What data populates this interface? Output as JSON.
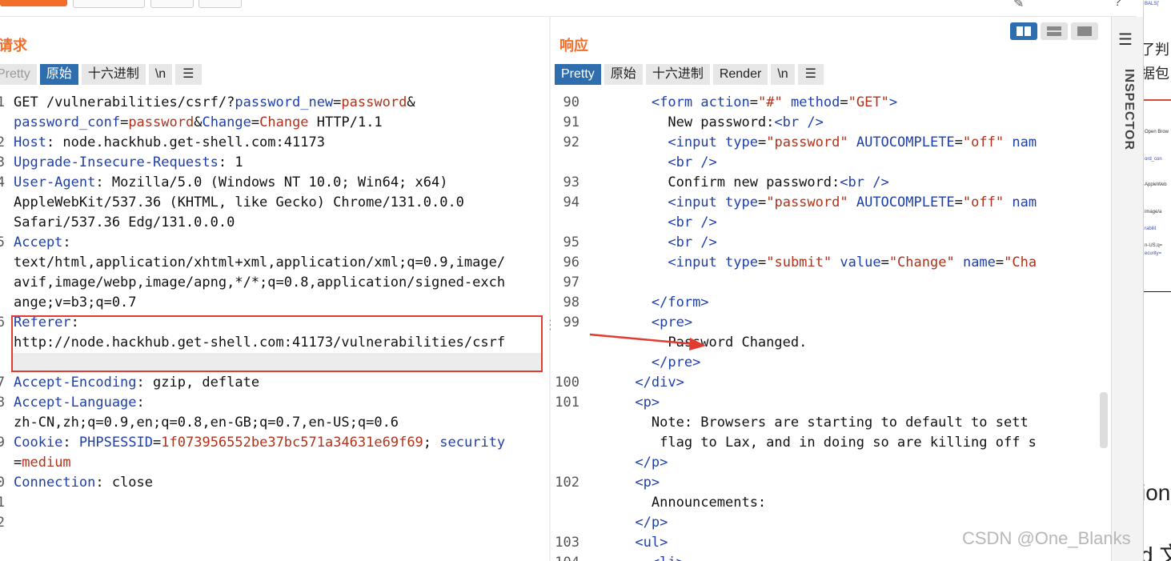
{
  "request": {
    "title": "请求",
    "tabs": [
      "Pretty",
      "原始",
      "十六进制",
      "\\n"
    ],
    "lines": [
      {
        "n": "1",
        "segs": [
          [
            "t",
            "GET /vulnerabilities/csrf/?"
          ],
          [
            "k",
            "password_new"
          ],
          [
            "t",
            "="
          ],
          [
            "v",
            "password"
          ],
          [
            "t",
            "&"
          ]
        ]
      },
      {
        "n": "",
        "segs": [
          [
            "k",
            "password_conf"
          ],
          [
            "t",
            "="
          ],
          [
            "v",
            "password"
          ],
          [
            "t",
            "&"
          ],
          [
            "k",
            "Change"
          ],
          [
            "t",
            "="
          ],
          [
            "v",
            "Change"
          ],
          [
            "t",
            " HTTP/1.1"
          ]
        ]
      },
      {
        "n": "2",
        "segs": [
          [
            "k",
            "Host"
          ],
          [
            "t",
            ": node.hackhub.get-shell.com:41173"
          ]
        ]
      },
      {
        "n": "3",
        "segs": [
          [
            "k",
            "Upgrade-Insecure-Requests"
          ],
          [
            "t",
            ": 1"
          ]
        ]
      },
      {
        "n": "4",
        "segs": [
          [
            "k",
            "User-Agent"
          ],
          [
            "t",
            ": Mozilla/5.0 (Windows NT 10.0; Win64; x64)"
          ]
        ]
      },
      {
        "n": "",
        "segs": [
          [
            "t",
            "AppleWebKit/537.36 (KHTML, like Gecko) Chrome/131.0.0.0"
          ]
        ]
      },
      {
        "n": "",
        "segs": [
          [
            "t",
            "Safari/537.36 Edg/131.0.0.0"
          ]
        ]
      },
      {
        "n": "5",
        "segs": [
          [
            "k",
            "Accept"
          ],
          [
            "t",
            ":"
          ]
        ]
      },
      {
        "n": "",
        "segs": [
          [
            "t",
            "text/html,application/xhtml+xml,application/xml;q=0.9,image/"
          ]
        ]
      },
      {
        "n": "",
        "segs": [
          [
            "t",
            "avif,image/webp,image/apng,*/*;q=0.8,application/signed-exch"
          ]
        ]
      },
      {
        "n": "",
        "segs": [
          [
            "t",
            "ange;v=b3;q=0.7"
          ]
        ]
      },
      {
        "n": "6",
        "segs": [
          [
            "k",
            "Referer"
          ],
          [
            "t",
            ":"
          ]
        ]
      },
      {
        "n": "",
        "segs": [
          [
            "t",
            "http://node.hackhub.get-shell.com:41173/vulnerabilities/csrf"
          ]
        ]
      },
      {
        "n": "",
        "segs": [
          [
            "t",
            "/"
          ]
        ]
      },
      {
        "n": "7",
        "segs": [
          [
            "k",
            "Accept-Encoding"
          ],
          [
            "t",
            ": gzip, deflate"
          ]
        ]
      },
      {
        "n": "8",
        "segs": [
          [
            "k",
            "Accept-Language"
          ],
          [
            "t",
            ":"
          ]
        ]
      },
      {
        "n": "",
        "segs": [
          [
            "t",
            "zh-CN,zh;q=0.9,en;q=0.8,en-GB;q=0.7,en-US;q=0.6"
          ]
        ]
      },
      {
        "n": "9",
        "segs": [
          [
            "k",
            "Cookie"
          ],
          [
            "t",
            ": "
          ],
          [
            "k",
            "PHPSESSID"
          ],
          [
            "t",
            "="
          ],
          [
            "v",
            "1f073956552be37bc571a34631e69f69"
          ],
          [
            "t",
            "; "
          ],
          [
            "k",
            "security"
          ]
        ]
      },
      {
        "n": "",
        "segs": [
          [
            "t",
            "="
          ],
          [
            "v",
            "medium"
          ]
        ]
      },
      {
        "n": "0",
        "segs": [
          [
            "k",
            "Connection"
          ],
          [
            "t",
            ": close"
          ]
        ]
      },
      {
        "n": "1",
        "segs": []
      },
      {
        "n": "2",
        "segs": []
      }
    ]
  },
  "response": {
    "title": "响应",
    "tabs": [
      "Pretty",
      "原始",
      "十六进制",
      "Render",
      "\\n"
    ],
    "lines": [
      {
        "n": "90",
        "segs": [
          [
            "t",
            "        "
          ],
          [
            "tag",
            "<form"
          ],
          [
            "t",
            " "
          ],
          [
            "attr",
            "action"
          ],
          [
            "t",
            "="
          ],
          [
            "str",
            "\"#\""
          ],
          [
            "t",
            " "
          ],
          [
            "attr",
            "method"
          ],
          [
            "t",
            "="
          ],
          [
            "str",
            "\"GET\""
          ],
          [
            "tag",
            ">"
          ]
        ]
      },
      {
        "n": "91",
        "segs": [
          [
            "t",
            "          New password:"
          ],
          [
            "tag",
            "<br />"
          ]
        ]
      },
      {
        "n": "92",
        "segs": [
          [
            "t",
            "          "
          ],
          [
            "tag",
            "<input"
          ],
          [
            "t",
            " "
          ],
          [
            "attr",
            "type"
          ],
          [
            "t",
            "="
          ],
          [
            "str",
            "\"password\""
          ],
          [
            "t",
            " "
          ],
          [
            "attr",
            "AUTOCOMPLETE"
          ],
          [
            "t",
            "="
          ],
          [
            "str",
            "\"off\""
          ],
          [
            "t",
            " "
          ],
          [
            "attr",
            "nam"
          ]
        ]
      },
      {
        "n": "",
        "segs": [
          [
            "t",
            "          "
          ],
          [
            "tag",
            "<br />"
          ]
        ]
      },
      {
        "n": "93",
        "segs": [
          [
            "t",
            "          Confirm new password:"
          ],
          [
            "tag",
            "<br />"
          ]
        ]
      },
      {
        "n": "94",
        "segs": [
          [
            "t",
            "          "
          ],
          [
            "tag",
            "<input"
          ],
          [
            "t",
            " "
          ],
          [
            "attr",
            "type"
          ],
          [
            "t",
            "="
          ],
          [
            "str",
            "\"password\""
          ],
          [
            "t",
            " "
          ],
          [
            "attr",
            "AUTOCOMPLETE"
          ],
          [
            "t",
            "="
          ],
          [
            "str",
            "\"off\""
          ],
          [
            "t",
            " "
          ],
          [
            "attr",
            "nam"
          ]
        ]
      },
      {
        "n": "",
        "segs": [
          [
            "t",
            "          "
          ],
          [
            "tag",
            "<br />"
          ]
        ]
      },
      {
        "n": "95",
        "segs": [
          [
            "t",
            "          "
          ],
          [
            "tag",
            "<br />"
          ]
        ]
      },
      {
        "n": "96",
        "segs": [
          [
            "t",
            "          "
          ],
          [
            "tag",
            "<input"
          ],
          [
            "t",
            " "
          ],
          [
            "attr",
            "type"
          ],
          [
            "t",
            "="
          ],
          [
            "str",
            "\"submit\""
          ],
          [
            "t",
            " "
          ],
          [
            "attr",
            "value"
          ],
          [
            "t",
            "="
          ],
          [
            "str",
            "\"Change\""
          ],
          [
            "t",
            " "
          ],
          [
            "attr",
            "name"
          ],
          [
            "t",
            "="
          ],
          [
            "str",
            "\"Cha"
          ]
        ]
      },
      {
        "n": "97",
        "segs": []
      },
      {
        "n": "98",
        "segs": [
          [
            "t",
            "        "
          ],
          [
            "tag",
            "</form>"
          ]
        ]
      },
      {
        "n": "99",
        "segs": [
          [
            "t",
            "        "
          ],
          [
            "tag",
            "<pre>"
          ]
        ]
      },
      {
        "n": "",
        "segs": [
          [
            "t",
            "          Password Changed."
          ]
        ]
      },
      {
        "n": "",
        "segs": [
          [
            "t",
            "        "
          ],
          [
            "tag",
            "</pre>"
          ]
        ]
      },
      {
        "n": "100",
        "segs": [
          [
            "t",
            "      "
          ],
          [
            "tag",
            "</div>"
          ]
        ]
      },
      {
        "n": "101",
        "segs": [
          [
            "t",
            "      "
          ],
          [
            "tag",
            "<p>"
          ]
        ]
      },
      {
        "n": "",
        "segs": [
          [
            "t",
            "        Note: Browsers are starting to default to sett"
          ]
        ]
      },
      {
        "n": "",
        "segs": [
          [
            "t",
            "         flag to Lax, and in doing so are killing off s"
          ]
        ]
      },
      {
        "n": "",
        "segs": [
          [
            "t",
            "      "
          ],
          [
            "tag",
            "</p>"
          ]
        ]
      },
      {
        "n": "102",
        "segs": [
          [
            "t",
            "      "
          ],
          [
            "tag",
            "<p>"
          ]
        ]
      },
      {
        "n": "",
        "segs": [
          [
            "t",
            "        Announcements:"
          ]
        ]
      },
      {
        "n": "",
        "segs": [
          [
            "t",
            "      "
          ],
          [
            "tag",
            "</p>"
          ]
        ]
      },
      {
        "n": "103",
        "segs": [
          [
            "t",
            "      "
          ],
          [
            "tag",
            "<ul>"
          ]
        ]
      },
      {
        "n": "104",
        "segs": [
          [
            "t",
            "        "
          ],
          [
            "tag",
            "<li>"
          ]
        ]
      }
    ]
  },
  "inspector": {
    "label": "INSPECTOR"
  },
  "edge": {
    "cn1": "了判",
    "cn2": "据包",
    "frag1": "ion",
    "frag2": "d 文",
    "mini": [
      "BALS['",
      "Open Brow",
      "ord_con",
      "AppleWeb",
      "image/a",
      "rabilit",
      "n-US;q=",
      "ecurity="
    ]
  },
  "watermark": "CSDN @One_Blanks",
  "colors": {
    "accent": "#f26f2a",
    "active_tab": "#2f6eae",
    "highlight": "#e23b32"
  }
}
